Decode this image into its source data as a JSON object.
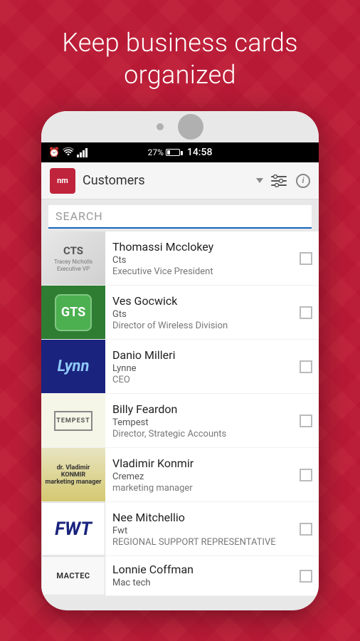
{
  "hero": {
    "line1": "Keep business cards",
    "line2": "organized"
  },
  "statusBar": {
    "time": "14:58",
    "batteryPercent": "27%"
  },
  "toolbar": {
    "title": "Customers",
    "logoText": "nm",
    "filterIcon": "⊞",
    "infoIcon": "i"
  },
  "search": {
    "placeholder": "SEARCH"
  },
  "contacts": [
    {
      "name": "Thomassi Mcclokey",
      "company": "Cts",
      "title": "Executive Vice President",
      "cardType": "cts"
    },
    {
      "name": "Ves Gocwick",
      "company": "Gts",
      "title": "Director of Wireless Division",
      "cardType": "gts"
    },
    {
      "name": "Danio Milleri",
      "company": "Lynne",
      "title": "CEO",
      "cardType": "lynn"
    },
    {
      "name": "Billy Feardon",
      "company": "Tempest",
      "title": "Director, Strategic Accounts",
      "cardType": "tempest"
    },
    {
      "name": "Vladimir Konmir",
      "company": "Cremez",
      "title": "marketing manager",
      "cardType": "konmir"
    },
    {
      "name": "Nee Mitchellio",
      "company": "Fwt",
      "title": "REGIONAL SUPPORT REPRESENTATIVE",
      "cardType": "fwt"
    },
    {
      "name": "Lonnie Coffman",
      "company": "Mac tech",
      "title": "",
      "cardType": "mactec"
    }
  ]
}
